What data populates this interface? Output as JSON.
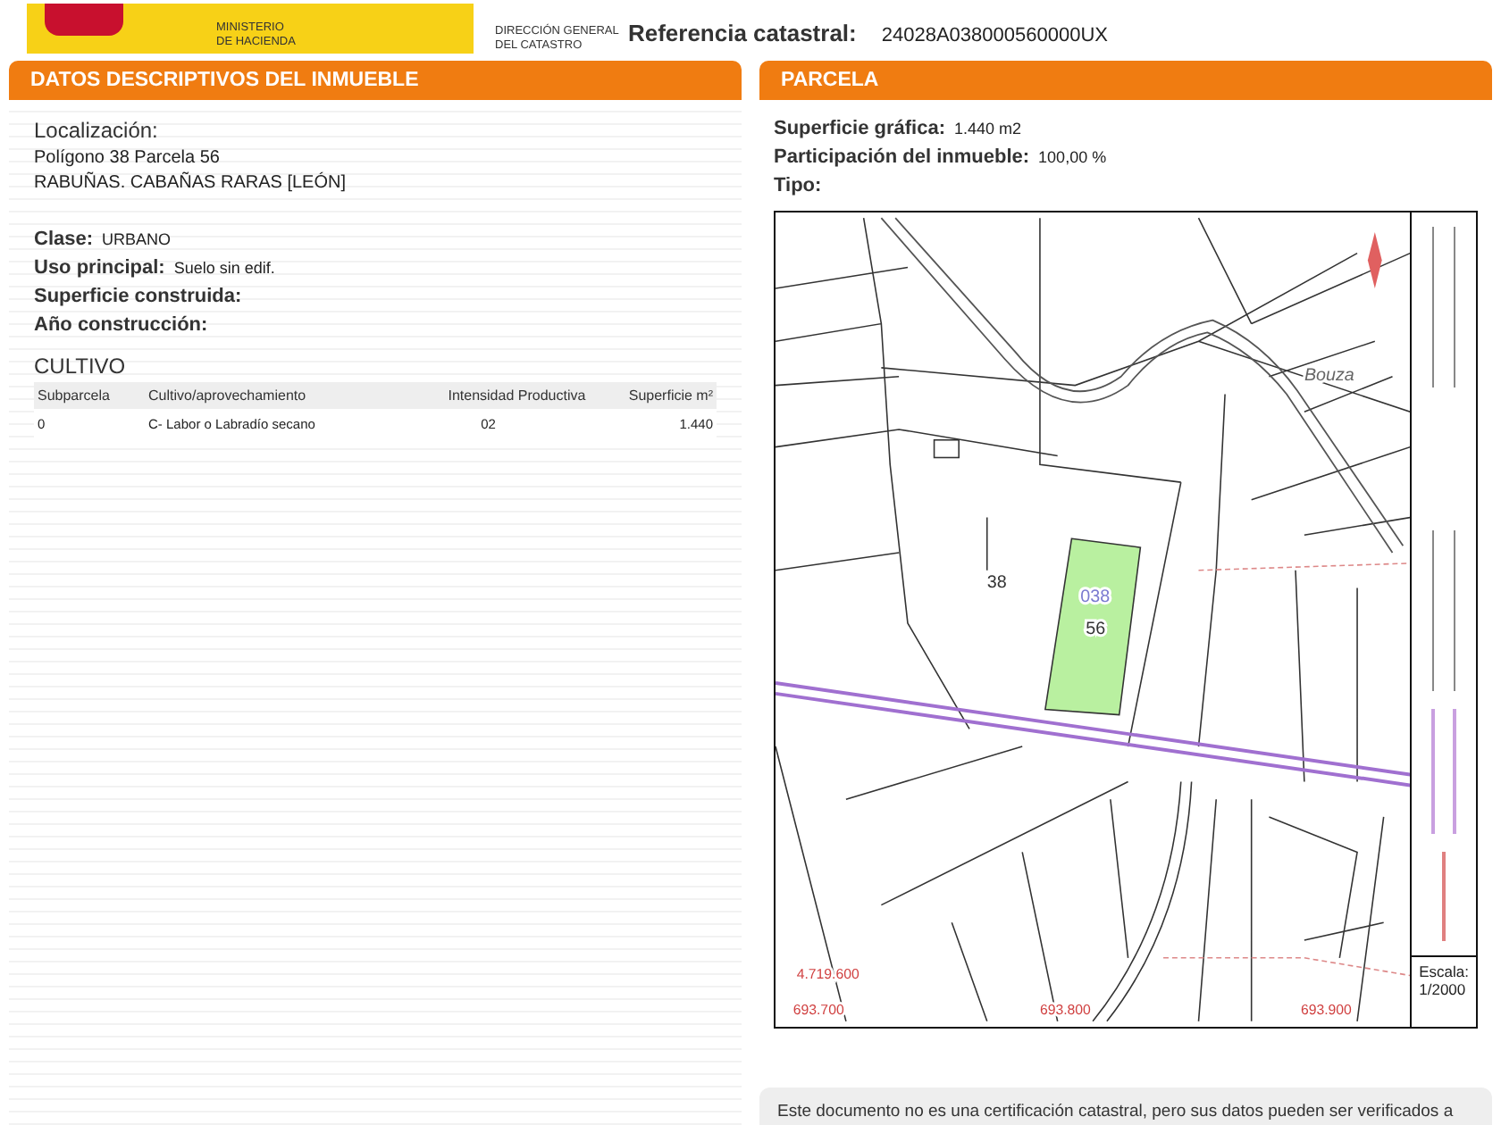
{
  "header": {
    "ministry": [
      "MINISTERIO",
      "DE HACIENDA"
    ],
    "agency": [
      "DIRECCIÓN GENERAL",
      "DEL CATASTRO"
    ],
    "reference_label": "Referencia catastral:",
    "reference": "24028A038000560000UX"
  },
  "left_panel": {
    "title": "DATOS DESCRIPTIVOS DEL INMUEBLE",
    "location_label": "Localización:",
    "location_lines": [
      "Polígono 38 Parcela 56",
      "RABUÑAS. CABAÑAS RARAS [LEÓN]"
    ],
    "fields": [
      {
        "label": "Clase:",
        "value": "URBANO"
      },
      {
        "label": "Uso principal:",
        "value": "Suelo sin edif."
      },
      {
        "label": "Superficie construida:"
      },
      {
        "label": "Año construcción:"
      }
    ],
    "cultivo": {
      "title": "CULTIVO",
      "columns": [
        "Subparcela",
        "Cultivo/aprovechamiento",
        "Intensidad Productiva",
        "Superficie m²"
      ],
      "rows": [
        [
          "0",
          "C- Labor o Labradío secano",
          "02",
          "1.440"
        ]
      ]
    }
  },
  "right_panel": {
    "title": "PARCELA",
    "fields": [
      {
        "label": "Superficie gráfica:",
        "value": "1.440 m2"
      },
      {
        "label": "Participación del inmueble:",
        "value": "100,00 %"
      },
      {
        "label": "Tipo:"
      }
    ],
    "map": {
      "labels": [
        {
          "text": "Bouza",
          "kind": "place"
        },
        {
          "text": "38",
          "kind": "parcel"
        },
        {
          "text": "038",
          "kind": "polygon"
        },
        {
          "text": "56",
          "kind": "parcel"
        },
        {
          "text": "4.719.600",
          "kind": "coordinate"
        },
        {
          "text": "693.700",
          "kind": "coordinate"
        },
        {
          "text": "693.800",
          "kind": "coordinate"
        },
        {
          "text": "693.900",
          "kind": "coordinate"
        }
      ],
      "scale_label": "Escala:",
      "scale": "1/2000"
    }
  },
  "note": "Este documento no es una certificación catastral, pero sus datos pueden ser verificados a"
}
